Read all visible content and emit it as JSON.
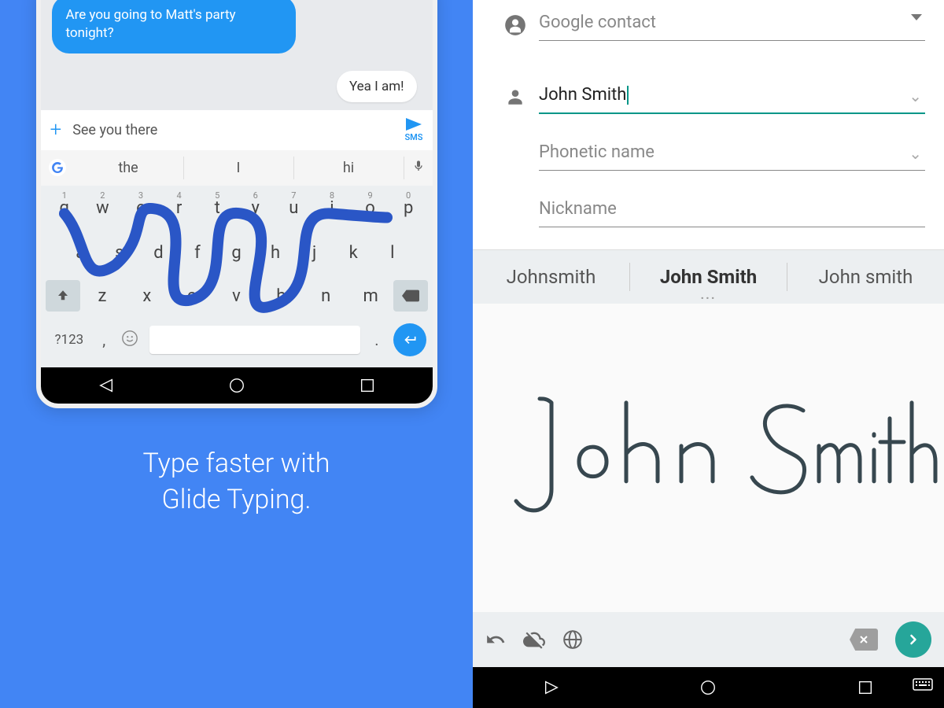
{
  "left": {
    "chat": {
      "outgoing": "Are you going to Matt's party tonight?",
      "incoming": "Yea I am!"
    },
    "compose": {
      "text": "See you there",
      "send_label": "SMS"
    },
    "suggestions": [
      "the",
      "I",
      "hi"
    ],
    "keyboard": {
      "row1_nums": [
        "1",
        "2",
        "3",
        "4",
        "5",
        "6",
        "7",
        "8",
        "9",
        "0"
      ],
      "row1": [
        "q",
        "w",
        "e",
        "r",
        "t",
        "y",
        "u",
        "i",
        "o",
        "p"
      ],
      "row2": [
        "a",
        "s",
        "d",
        "f",
        "g",
        "h",
        "j",
        "k",
        "l"
      ],
      "row3": [
        "z",
        "x",
        "c",
        "v",
        "b",
        "n",
        "m"
      ],
      "symbols_key": "?123",
      "comma": ",",
      "period": "."
    },
    "tagline": "Type faster with\nGlide Typing."
  },
  "right": {
    "contact_type": "Google contact",
    "name_value": "John Smith",
    "phonetic_label": "Phonetic name",
    "nickname_label": "Nickname",
    "hw_suggestions": [
      "Johnsmith",
      "John Smith",
      "John smith"
    ],
    "handwritten_text": "John Smith"
  }
}
